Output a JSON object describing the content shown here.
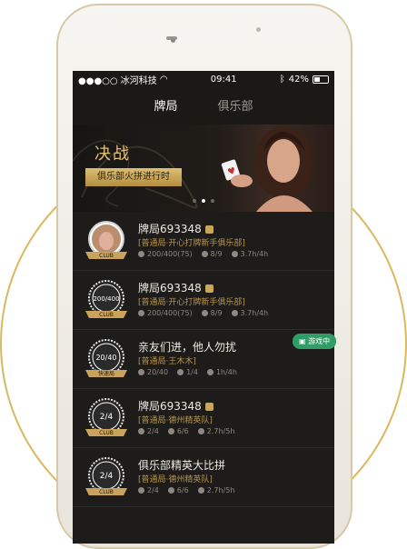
{
  "status_bar": {
    "carrier": "●●●○○ 冰河科技",
    "time": "09:41",
    "battery": "42%"
  },
  "tabs": [
    {
      "label": "牌局",
      "active": true
    },
    {
      "label": "俱乐部",
      "active": false
    }
  ],
  "banner": {
    "title": "决战",
    "tag": "俱乐部火拼进行时",
    "pages": 3,
    "active_page": 1
  },
  "rows": [
    {
      "title": "牌局693348",
      "sub": "[普通局·开心打牌新手俱乐部]",
      "chips": "200/400(75)",
      "players": "8/9",
      "time": "3.7h/4h",
      "badge_top": "",
      "badge_bottom": "CLUB",
      "avatar": true
    },
    {
      "title": "牌局693348",
      "sub": "[普通局·开心打牌新手俱乐部]",
      "chips": "200/400(75)",
      "players": "8/9",
      "time": "3.7h/4h",
      "badge_top": "200/400",
      "badge_bottom": "CLUB",
      "avatar": false
    },
    {
      "title": "亲友们进，他人勿扰",
      "sub": "[普通局·王木木]",
      "chips": "20/40",
      "players": "1/4",
      "time": "1h/4h",
      "badge_top": "20/40",
      "badge_bottom": "快速局",
      "avatar": false,
      "status": "游戏中"
    },
    {
      "title": "牌局693348",
      "sub": "[普通局·德州精英队]",
      "chips": "2/4",
      "players": "6/6",
      "time": "2.7h/5h",
      "badge_top": "2/4",
      "badge_bottom": "CLUB",
      "avatar": false
    },
    {
      "title": "俱乐部精英大比拼",
      "sub": "[普通局·德州精英队]",
      "chips": "2/4",
      "players": "6/6",
      "time": "2.7h/5h",
      "badge_top": "2/4",
      "badge_bottom": "CLUB",
      "avatar": false
    }
  ],
  "colors": {
    "gold": "#d7b25e",
    "bg": "#1d1c1a",
    "green": "#35a36a"
  }
}
